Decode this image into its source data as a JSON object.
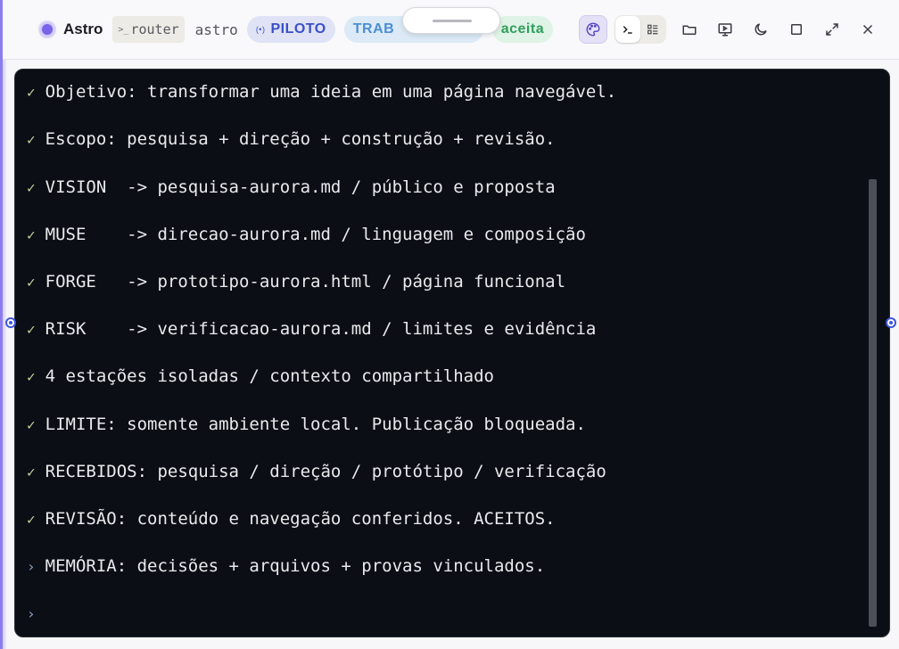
{
  "header": {
    "app_name": "Astro",
    "router_label": "router",
    "agent_label": "astro",
    "mode_pill": "PILOTO",
    "work_pill": "TRAB",
    "state_pill": "aceita"
  },
  "icons": {
    "palette": "palette-icon",
    "terminal": "terminal-icon",
    "board": "board-icon",
    "folder": "folder-icon",
    "preview": "preview-icon",
    "theme": "moon-icon",
    "window": "square-icon",
    "expand": "expand-icon",
    "close": "close-icon"
  },
  "terminal": {
    "lines": [
      {
        "mark": "✓",
        "text": "Objetivo: transformar uma ideia em uma página navegável."
      },
      {
        "mark": "✓",
        "text": "Escopo: pesquisa + direção + construção + revisão."
      },
      {
        "mark": "✓",
        "text": "VISION  -> pesquisa-aurora.md / público e proposta"
      },
      {
        "mark": "✓",
        "text": "MUSE    -> direcao-aurora.md / linguagem e composição"
      },
      {
        "mark": "✓",
        "text": "FORGE   -> prototipo-aurora.html / página funcional"
      },
      {
        "mark": "✓",
        "text": "RISK    -> verificacao-aurora.md / limites e evidência"
      },
      {
        "mark": "✓",
        "text": "4 estações isoladas / contexto compartilhado"
      },
      {
        "mark": "✓",
        "text": "LIMITE: somente ambiente local. Publicação bloqueada."
      },
      {
        "mark": "✓",
        "text": "RECEBIDOS: pesquisa / direção / protótipo / verificação"
      },
      {
        "mark": "✓",
        "text": "REVISÃO: conteúdo e navegação conferidos. ACEITOS."
      },
      {
        "mark": "›",
        "text": "MEMÓRIA: decisões + arquivos + provas vinculados."
      },
      {
        "mark": "›",
        "text": ""
      }
    ]
  },
  "colors": {
    "accent": "#7a63e8",
    "terminal_bg": "#0b0e14",
    "check": "#c7d79a",
    "piloto": "#3a4fc9",
    "aceita": "#2f9f5c"
  }
}
